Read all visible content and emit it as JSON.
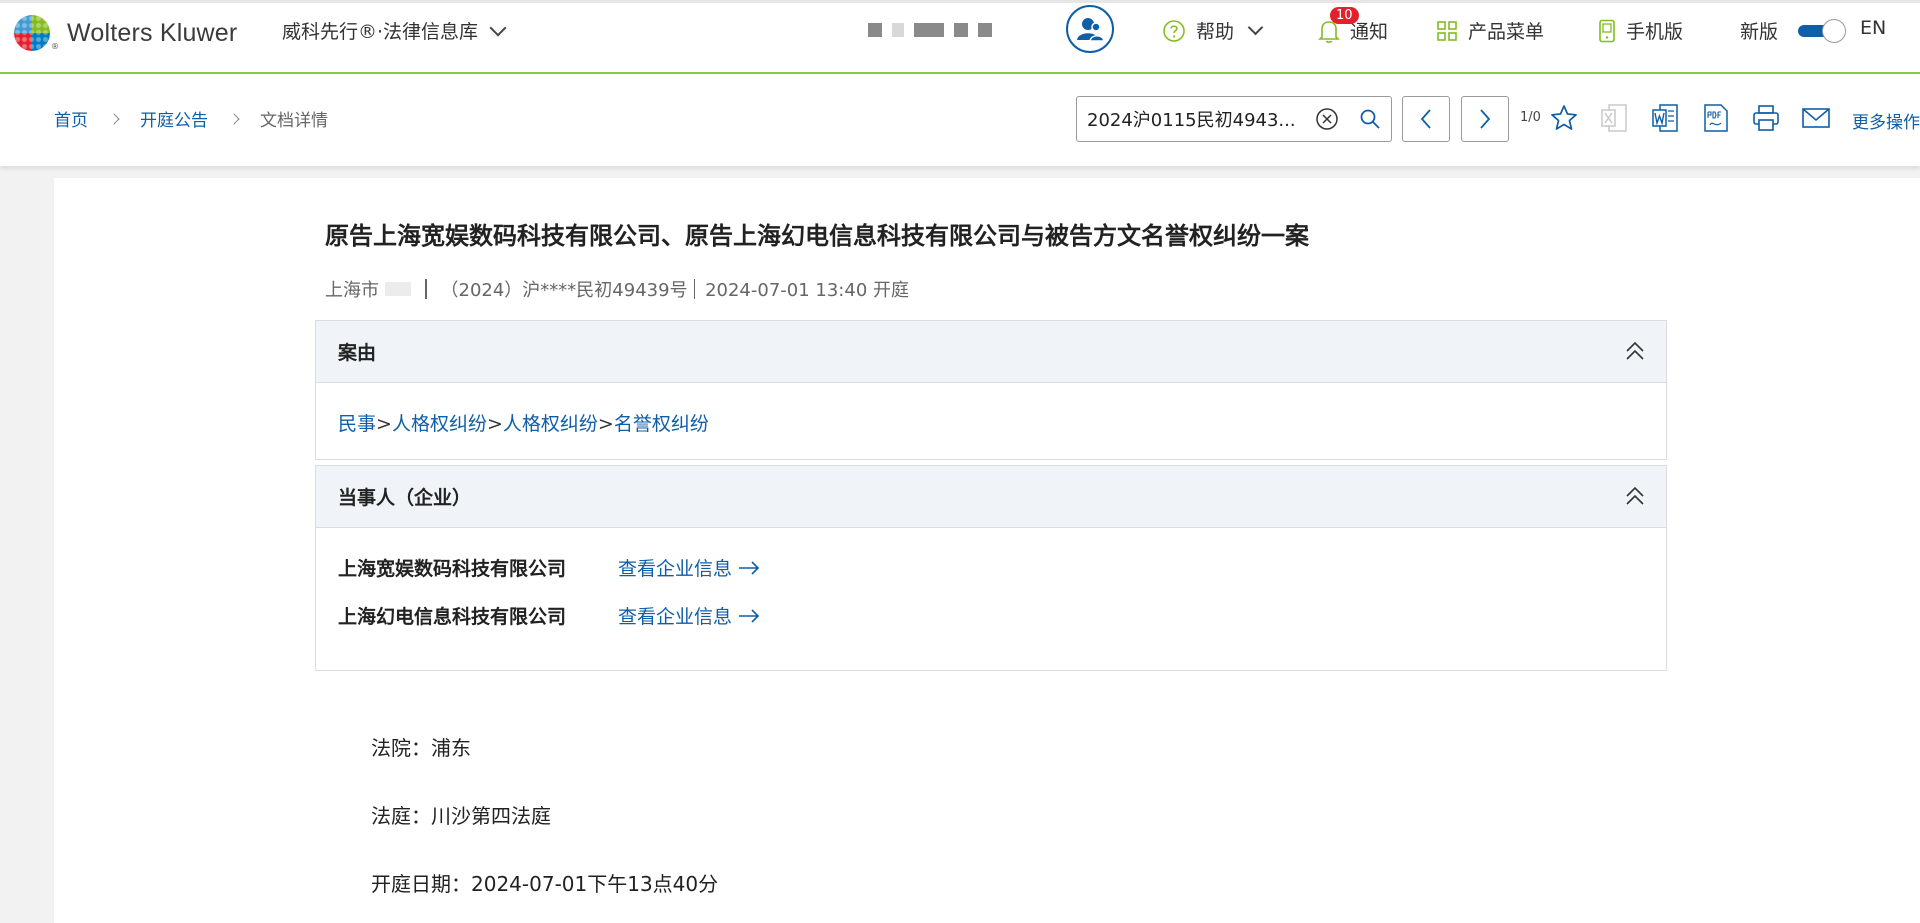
{
  "header": {
    "logo_text": "Wolters Kluwer",
    "logo_reg": "®",
    "product_name": "威科先行®·法律信息库",
    "help_label": "帮助",
    "notice_label": "通知",
    "notice_count": "10",
    "products_label": "产品菜单",
    "mobile_label": "手机版",
    "new_version_label": "新版",
    "new_version_on": true,
    "language_label": "EN"
  },
  "breadcrumb": {
    "home": "首页",
    "section": "开庭公告",
    "current": "文档详情"
  },
  "toolbar": {
    "search_value": "2024沪0115民初4943...",
    "page_counter": "1/0",
    "more_label": "更多操作"
  },
  "document": {
    "title": "原告上海宽娱数码科技有限公司、原告上海幻电信息科技有限公司与被告方文名誉权纠纷一案",
    "meta_location": "上海市",
    "meta_case_no": "（2024）沪****民初49439号",
    "meta_datetime": "2024-07-01 13:40 开庭",
    "cause_section": {
      "title": "案由",
      "path": [
        "民事",
        "人格权纠纷",
        "人格权纠纷",
        "名誉权纠纷"
      ],
      "separator": ">"
    },
    "parties_section": {
      "title": "当事人（企业）",
      "parties": [
        {
          "name": "上海宽娱数码科技有限公司",
          "link_label": "查看企业信息"
        },
        {
          "name": "上海幻电信息科技有限公司",
          "link_label": "查看企业信息"
        }
      ]
    },
    "court": "法院：浦东",
    "courtroom": "法庭：川沙第四法庭",
    "hearing_date": "开庭日期：2024-07-01下午13点40分"
  },
  "colors": {
    "brand_blue": "#0f5ea8",
    "accent_green": "#8dc63f",
    "badge_red": "#e5202e"
  }
}
